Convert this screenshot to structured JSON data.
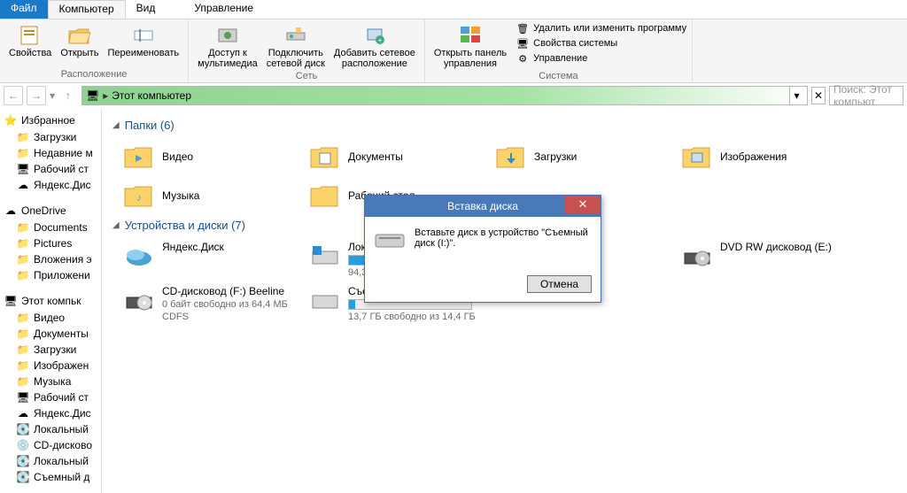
{
  "ribbon": {
    "tabs": {
      "file": "Файл",
      "computer": "Компьютер",
      "view": "Вид",
      "manage": "Управление"
    },
    "group1": {
      "label": "Расположение",
      "properties": "Свойства",
      "open": "Открыть",
      "rename": "Переименовать"
    },
    "group2": {
      "label": "Сеть",
      "media": "Доступ к\nмультимедиа",
      "netdrive": "Подключить\nсетевой диск",
      "addnet": "Добавить сетевое\nрасположение"
    },
    "group3": {
      "label": "Система",
      "panel": "Открыть панель\nуправления",
      "uninstall": "Удалить или изменить программу",
      "sysprops": "Свойства системы",
      "manage": "Управление"
    }
  },
  "navbar": {
    "path": "Этот компьютер",
    "search_placeholder": "Поиск: Этот компьют"
  },
  "sidebar": {
    "favorites": {
      "header": "Избранное",
      "items": [
        "Загрузки",
        "Недавние м",
        "Рабочий ст",
        "Яндекс.Дис"
      ]
    },
    "onedrive": {
      "header": "OneDrive",
      "items": [
        "Documents",
        "Pictures",
        "Вложения э",
        "Приложени"
      ]
    },
    "thispc": {
      "header": "Этот компьк",
      "items": [
        "Видео",
        "Документы",
        "Загрузки",
        "Изображен",
        "Музыка",
        "Рабочий ст",
        "Яндекс.Дис",
        "Локальный",
        "CD-дисково",
        "Локальный",
        "Съемный д"
      ]
    }
  },
  "content": {
    "folders_header": "Папки (6)",
    "folders": [
      "Видео",
      "Документы",
      "Загрузки",
      "Изображения",
      "Музыка",
      "Рабочий стол"
    ],
    "drives_header": "Устройства и диски (7)",
    "yandex": "Яндекс.Диск",
    "local_c": {
      "name": "Локальн",
      "sub": "94,3 ГБ с"
    },
    "dvd": "DVD RW дисковод (E:)",
    "cdrom": {
      "name": "CD-дисковод (F:) Beeline",
      "sub": "0 байт свободно из 64,4 МБ",
      "fs": "CDFS"
    },
    "removable": {
      "name": "Съемны",
      "sub": "13,7 ГБ свободно из 14,4 ГБ"
    }
  },
  "dialog": {
    "title": "Вставка диска",
    "message": "Вставьте диск в устройство \"Съемный диск (I:)\".",
    "cancel": "Отмена"
  }
}
